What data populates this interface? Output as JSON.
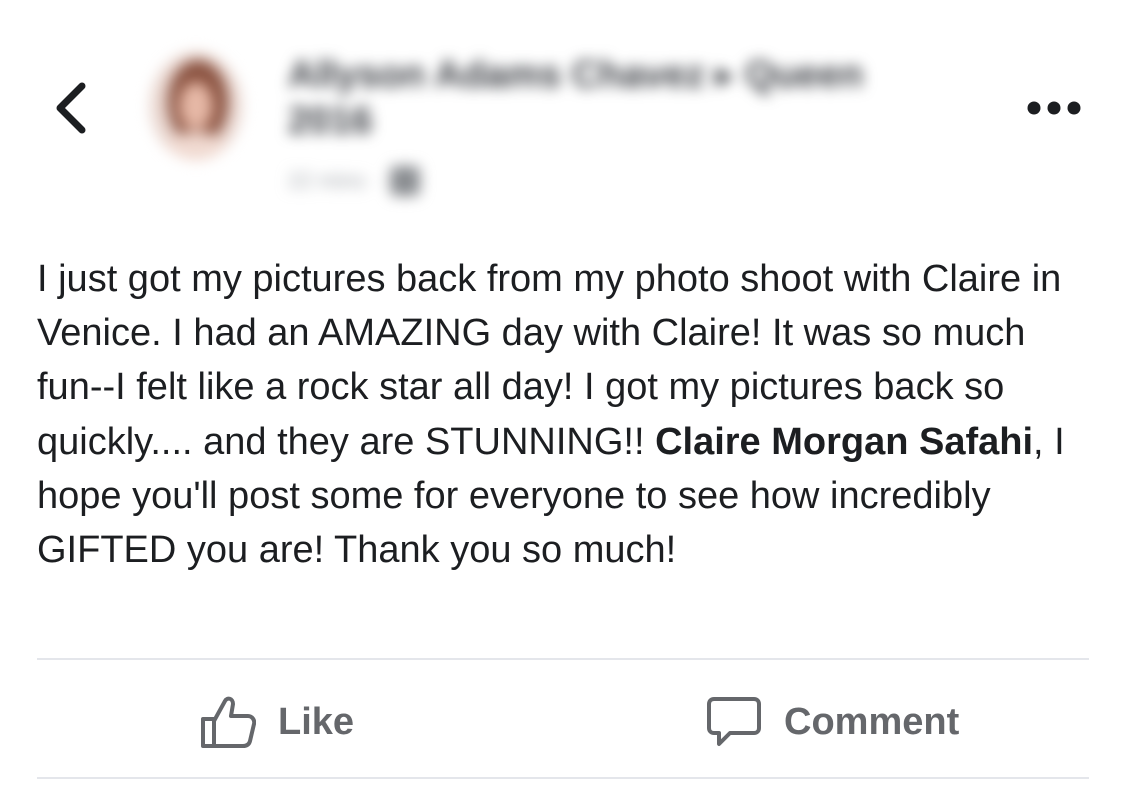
{
  "header": {
    "back_icon": "chevron-left-icon",
    "author_name": "Allyson Adams Chavez ▸ Queen 2016",
    "post_meta": "22 mins ·",
    "privacy_icon": "globe-icon",
    "more_icon": "more-dots-icon"
  },
  "post": {
    "text_before_mention": "I just got my pictures back from my photo shoot with Claire in Venice. I had an AMAZING day with Claire! It was so much fun--I felt like a rock star all day! I got my pictures back so quickly.... and they are STUNNING!! ",
    "mention": "Claire Morgan Safahi",
    "text_after_mention": ", I hope you'll post some for everyone to see how incredibly GIFTED you are! Thank you so much!"
  },
  "actions": {
    "like_label": "Like",
    "like_icon": "thumbs-up-icon",
    "comment_label": "Comment",
    "comment_icon": "comment-bubble-icon"
  },
  "colors": {
    "text": "#1c1e21",
    "action_gray": "#65676b",
    "divider": "#e4e6eb"
  }
}
